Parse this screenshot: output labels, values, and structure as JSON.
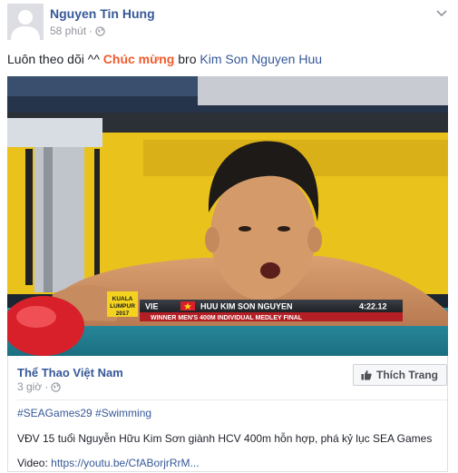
{
  "post": {
    "author": "Nguyen Tin Hung",
    "time": "58 phút",
    "text_prefix": "Luôn theo dõi ^^",
    "highlight": "Chúc mừng",
    "text_mid": "bro",
    "tagged": "Kim Son Nguyen Huu"
  },
  "video": {
    "logo_line1": "KUALA",
    "logo_line2": "LUMPUR",
    "logo_line3": "2017",
    "country": "VIE",
    "swimmer_name": "HUU KIM SON NGUYEN",
    "time": "4:22.12",
    "caption": "WINNER MEN'S 400M INDIVIDUAL MEDLEY FINAL"
  },
  "share": {
    "page_name": "Thể Thao Việt Nam",
    "time": "3 giờ",
    "like_button": "Thích Trang",
    "hashtags": "#SEAGames29 #Swimming",
    "description": "VĐV 15 tuổi Nguyễn Hữu Kim Sơn giành HCV 400m hỗn hợp, phá kỷ lục SEA Games",
    "video_label": "Video:",
    "video_link": "https://youtu.be/CfABorjrRrM..."
  },
  "icons": {
    "audience": "globe-icon",
    "menu": "chevron-down-icon",
    "like": "thumbs-up-icon"
  },
  "colors": {
    "link": "#365899",
    "highlight": "#f15b2b",
    "muted": "#90949c"
  }
}
